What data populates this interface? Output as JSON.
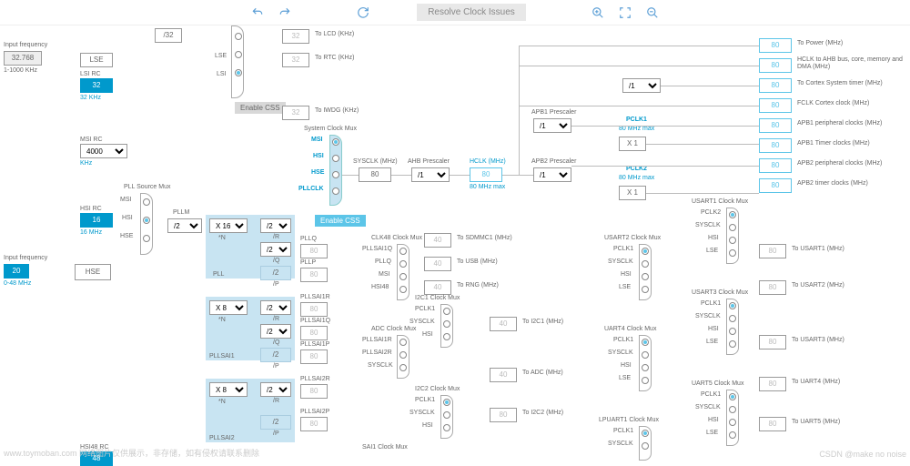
{
  "toolbar": {
    "resolve_label": "Resolve Clock Issues"
  },
  "left_panel": {
    "input_freq_label": "Input frequency",
    "input_freq_val": "32.768",
    "input_freq_range": "1-1000 KHz",
    "input_freq2_label": "Input frequency",
    "input_freq2_val": "20",
    "input_freq2_range": "0-48 MHz"
  },
  "osc": {
    "lse_label": "LSE",
    "lsi_rc_label": "LSI RC",
    "lsi_val": "32",
    "lsi_unit": "32 KHz",
    "msi_rc_label": "MSI RC",
    "msi_val": "4000",
    "msi_unit": "KHz",
    "hsi_rc_label": "HSI RC",
    "hsi_val": "16",
    "hsi_unit": "16 MHz",
    "hse_label": "HSE",
    "hsi48_rc_label": "HSI48 RC"
  },
  "divs": {
    "div32": "/32",
    "div1": "/1",
    "div2": "/2",
    "x1": "X 1",
    "x16": "X 16",
    "x8": "X 8"
  },
  "rtc": {
    "lcd_val": "32",
    "lcd_label": "To LCD (KHz)",
    "rtc_val": "32",
    "rtc_label": "To RTC (KHz)",
    "iwdg_val": "32",
    "iwdg_label": "To IWDG (KHz)",
    "enable_css": "Enable CSS"
  },
  "sysmux": {
    "title": "System Clock Mux",
    "msi": "MSI",
    "hsi": "HSI",
    "hse": "HSE",
    "pllclk": "PLLCLK",
    "enable_css": "Enable CSS"
  },
  "pll": {
    "src_label": "PLL Source Mux",
    "pllm": "PLLM",
    "pll_label": "PLL",
    "n_label": "*N",
    "r_label": "/R",
    "q_label": "/Q",
    "p_label": "/P",
    "pllq": "PLLQ",
    "pllq_val": "80",
    "pllp": "PLLP",
    "pllp_val": "80",
    "pllsai1": "PLLSAI1",
    "pllsai1r": "PLLSAI1R",
    "pllsai1r_val": "80",
    "pllsai1q": "PLLSAI1Q",
    "pllsai1q_val": "80",
    "pllsai1p": "PLLSAI1P",
    "pllsai1p_val": "80",
    "pllsai2": "PLLSAI2",
    "pllsai2r": "PLLSAI2R",
    "pllsai2r_val": "80",
    "pllsai2p": "PLLSAI2P",
    "pllsai2p_val": "80"
  },
  "main": {
    "sysclk_label": "SYSCLK (MHz)",
    "sysclk_val": "80",
    "ahb_label": "AHB Prescaler",
    "hclk_label": "HCLK (MHz)",
    "hclk_val": "80",
    "hclk_max": "80 MHz max",
    "apb1_label": "APB1 Prescaler",
    "apb2_label": "APB2 Prescaler",
    "pclk1": "PCLK1",
    "pclk1_max": "80 MHz max",
    "pclk2": "PCLK2",
    "pclk2_max": "80 MHz max"
  },
  "outputs": {
    "power_val": "80",
    "power_label": "To Power (MHz)",
    "ahb_val": "80",
    "ahb_label": "HCLK to AHB bus, core, memory and DMA (MHz)",
    "cortex_val": "80",
    "cortex_label": "To Cortex System timer (MHz)",
    "fclk_val": "80",
    "fclk_label": "FCLK Cortex clock (MHz)",
    "apb1p_val": "80",
    "apb1p_label": "APB1 peripheral clocks (MHz)",
    "apb1t_val": "80",
    "apb1t_label": "APB1 Timer clocks (MHz)",
    "apb2p_val": "80",
    "apb2p_label": "APB2 peripheral clocks (MHz)",
    "apb2t_val": "80",
    "apb2t_label": "APB2 timer clocks (MHz)"
  },
  "clk48": {
    "title": "CLK48 Clock Mux",
    "pllsai1q": "PLLSAI1Q",
    "pllq": "PLLQ",
    "msi": "MSI",
    "hsi48": "HSI48",
    "sdmmc_val": "40",
    "sdmmc_label": "To SDMMC1 (MHz)",
    "usb_val": "40",
    "usb_label": "To USB (MHz)",
    "rng_val": "40",
    "rng_label": "To RNG (MHz)"
  },
  "adc": {
    "title": "ADC Clock Mux",
    "pllsai1r": "PLLSAI1R",
    "pllsai2r": "PLLSAI2R",
    "sysclk": "SYSCLK",
    "val": "40",
    "label": "To ADC (MHz)"
  },
  "i2c1": {
    "title": "I2C1 Clock Mux",
    "pclk1": "PCLK1",
    "sysclk": "SYSCLK",
    "hsi": "HSI",
    "val": "40",
    "label": "To I2C1 (MHz)"
  },
  "i2c2": {
    "title": "I2C2 Clock Mux",
    "pclk1": "PCLK1",
    "sysclk": "SYSCLK",
    "hsi": "HSI",
    "val": "80",
    "label": "To I2C2 (MHz)"
  },
  "sai1": {
    "title": "SAI1 Clock Mux"
  },
  "usart1": {
    "title": "USART1 Clock Mux",
    "pclk2": "PCLK2",
    "sysclk": "SYSCLK",
    "hsi": "HSI",
    "lse": "LSE",
    "val": "80",
    "label": "To USART1 (MHz)"
  },
  "usart2": {
    "title": "USART2 Clock Mux",
    "pclk1": "PCLK1",
    "sysclk": "SYSCLK",
    "hsi": "HSI",
    "lse": "LSE",
    "val": "80",
    "label": "To USART2 (MHz)"
  },
  "usart3": {
    "title": "USART3 Clock Mux",
    "pclk1": "PCLK1",
    "sysclk": "SYSCLK",
    "hsi": "HSI",
    "lse": "LSE",
    "val": "80",
    "label": "To USART3 (MHz)"
  },
  "uart4": {
    "title": "UART4 Clock Mux",
    "pclk1": "PCLK1",
    "sysclk": "SYSCLK",
    "hsi": "HSI",
    "lse": "LSE",
    "val": "80",
    "label": "To UART4 (MHz)"
  },
  "uart5": {
    "title": "UART5 Clock Mux",
    "pclk1": "PCLK1",
    "sysclk": "SYSCLK",
    "hsi": "HSI",
    "lse": "LSE",
    "val": "80",
    "label": "To UART5 (MHz)"
  },
  "lpuart1": {
    "title": "LPUART1 Clock Mux"
  },
  "watermarks": {
    "left": "www.toymoban.com 网络图片仅供展示，非存储，如有侵权请联系删除",
    "right": "CSDN @make no noise"
  }
}
